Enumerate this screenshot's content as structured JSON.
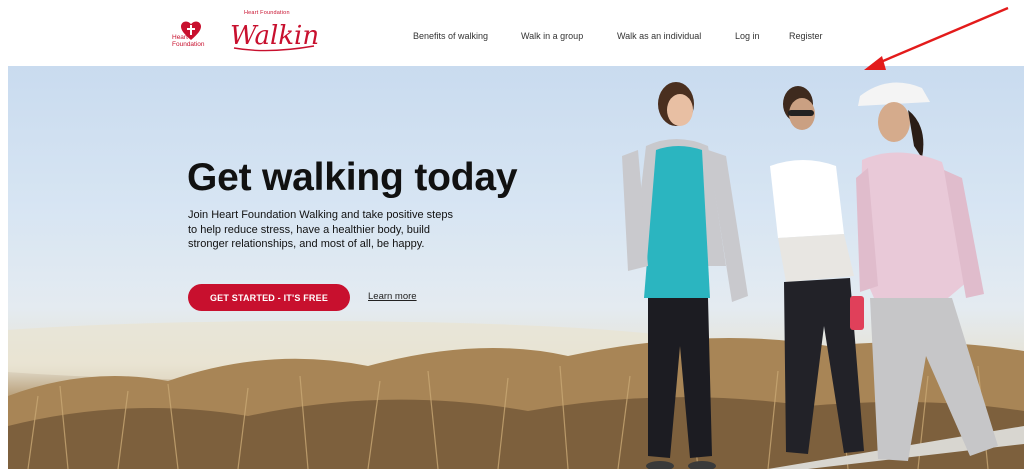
{
  "header": {
    "logo": {
      "org_name": "Heart Foundation",
      "org_label_line1": "Heart",
      "org_label_line2": "Foundation",
      "product_tagline": "Heart Foundation",
      "product_name": "Walking"
    },
    "nav": [
      {
        "label": "Benefits of walking"
      },
      {
        "label": "Walk in a group"
      },
      {
        "label": "Walk as an individual"
      },
      {
        "label": "Log in"
      },
      {
        "label": "Register"
      }
    ]
  },
  "hero": {
    "title": "Get walking today",
    "description": "Join Heart Foundation Walking and take positive steps to help reduce stress, have a healthier body, build stronger relationships, and most of all, be happy.",
    "cta_label": "GET STARTED - IT'S FREE",
    "learn_more_label": "Learn more"
  },
  "colors": {
    "brand_red": "#c8102e",
    "annotation_arrow": "#e31b1b"
  },
  "icons": [
    "heart-foundation-logo-icon",
    "annotation-arrow-icon"
  ]
}
